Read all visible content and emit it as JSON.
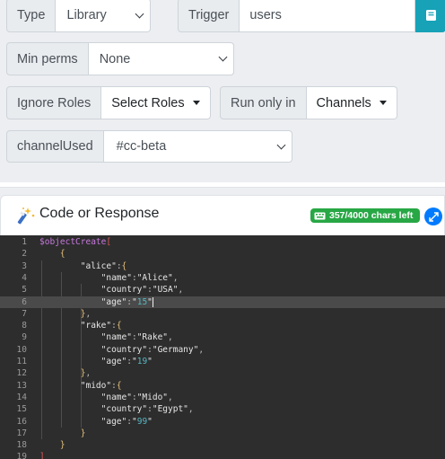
{
  "row1": {
    "type_label": "Type",
    "type_value": "Library",
    "trigger_label": "Trigger",
    "trigger_value": "users"
  },
  "row2": {
    "minperms_label": "Min perms",
    "minperms_value": "None"
  },
  "row3": {
    "ignore_label": "Ignore Roles",
    "ignore_value": "Select Roles",
    "runonly_label": "Run only in",
    "runonly_value": "Channels"
  },
  "row4": {
    "channel_label": "channelUsed",
    "channel_value": "#cc-beta"
  },
  "card": {
    "title": "Code or Response",
    "chars_left": "357/4000 chars left"
  },
  "colors": {
    "teal": "#17a2b8",
    "success": "#28a745",
    "primary": "#007bff",
    "editor_bg": "#2d2d2d"
  },
  "icons": {
    "trigger_button": "book-icon",
    "header": "magic-wand-icon",
    "badge": "keyboard-icon",
    "expand": "expand-icon"
  },
  "editor": {
    "line_numbers": [
      "1",
      "2",
      "3",
      "4",
      "5",
      "6",
      "7",
      "8",
      "9",
      "10",
      "11",
      "12",
      "13",
      "14",
      "15",
      "16",
      "17",
      "18",
      "19"
    ],
    "lines": [
      "$objectCreate[",
      "    {",
      "        \"alice\":{",
      "            \"name\":\"Alice\",",
      "            \"country\":\"USA\",",
      "            \"age\":\"15\"",
      "        },",
      "        \"rake\":{",
      "            \"name\":\"Rake\",",
      "            \"country\":\"Germany\",",
      "            \"age\":\"19\"",
      "        },",
      "        \"mido\":{",
      "            \"name\":\"Mido\",",
      "            \"country\":\"Egypt\",",
      "            \"age\":\"99\"",
      "        }",
      "    }",
      "]"
    ],
    "active_line": 6
  }
}
